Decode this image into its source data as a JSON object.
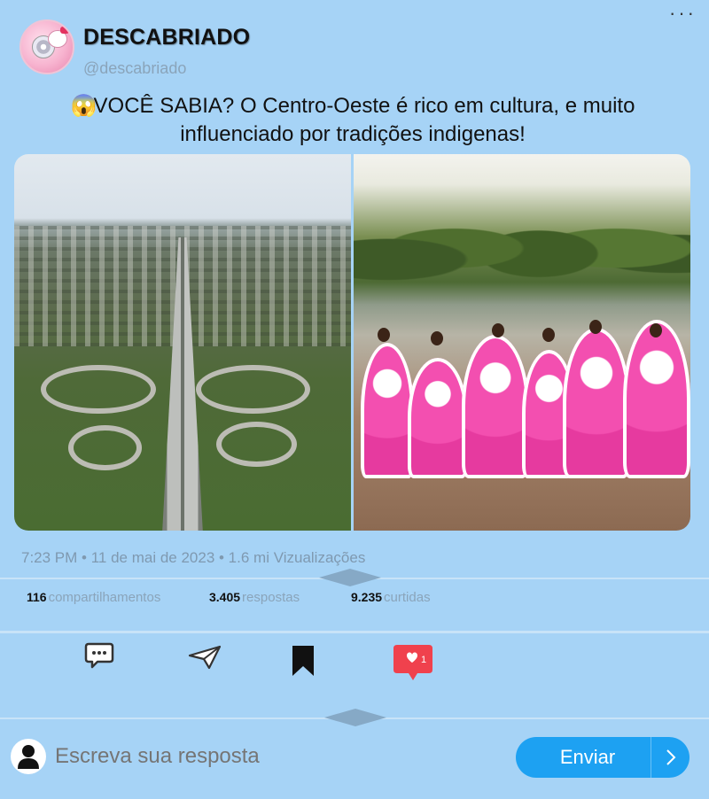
{
  "post": {
    "display_name": "DESCABRIADO",
    "handle": "@descabriado",
    "text_emoji": "😱",
    "text": "VOCÊ SABIA? O Centro-Oeste é rico em cultura, e muito influenciado por tradições indigenas!",
    "meta": "7:23 PM • 11 de mai de 2023 • 1.6 mi Vizualizações"
  },
  "stats": {
    "shares_count": "116",
    "shares_label": "compartilhamentos",
    "replies_count": "3.405",
    "replies_label": "respostas",
    "likes_count": "9.235",
    "likes_label": "curtidas"
  },
  "actions": {
    "like_badge": "1"
  },
  "reply": {
    "placeholder": "Escreva sua resposta",
    "send_label": "Enviar"
  },
  "icons": {
    "more": "more-horizontal-icon",
    "reply": "chat-bubble-icon",
    "share": "paper-plane-icon",
    "save": "bookmark-icon",
    "like": "heart-icon",
    "user": "user-icon",
    "send": "chevron-right-icon"
  },
  "colors": {
    "background": "#a6d3f6",
    "accent": "#1da1f2",
    "like_red": "#f0414d",
    "muted_text": "#8aa4ba"
  }
}
